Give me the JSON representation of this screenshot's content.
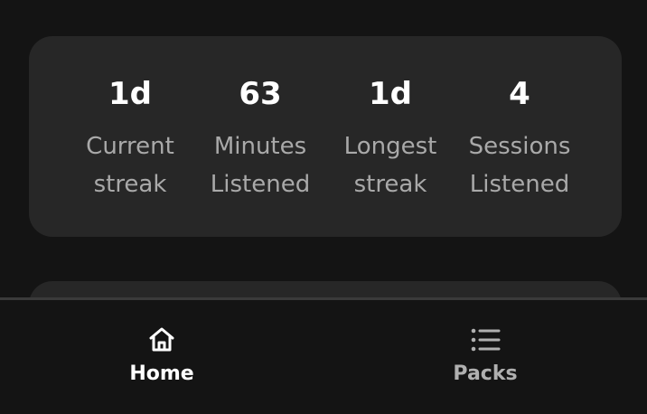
{
  "stats": [
    {
      "value": "1d",
      "label": "Current\nstreak"
    },
    {
      "value": "63",
      "label": "Minutes\nListened"
    },
    {
      "value": "1d",
      "label": "Longest\nstreak"
    },
    {
      "value": "4",
      "label": "Sessions\nListened"
    }
  ],
  "nav": {
    "home": {
      "label": "Home",
      "icon": "home-icon",
      "active": true
    },
    "packs": {
      "label": "Packs",
      "icon": "list-icon",
      "active": false
    }
  },
  "colors": {
    "background": "#141414",
    "card": "#272727",
    "active": "#ffffff",
    "inactive": "#b0b0b0",
    "label": "#a9a9a9"
  }
}
